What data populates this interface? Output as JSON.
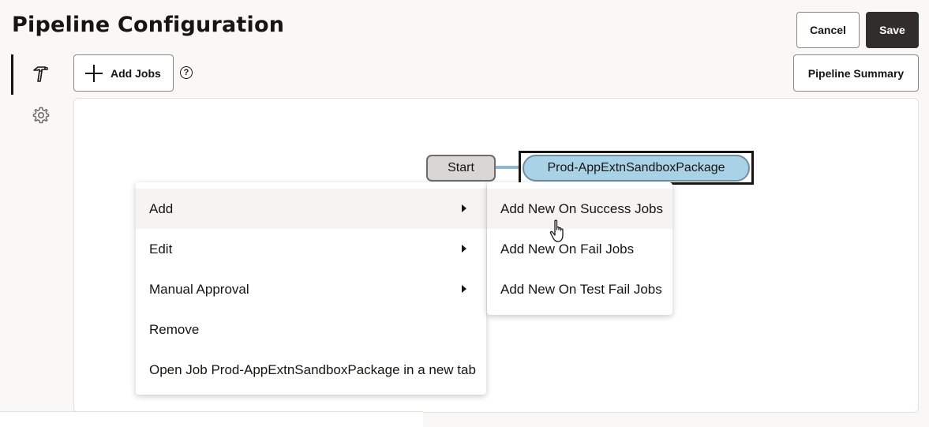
{
  "header": {
    "title": "Pipeline Configuration",
    "cancel_label": "Cancel",
    "save_label": "Save"
  },
  "toolbar": {
    "add_jobs_label": "Add Jobs",
    "help_glyph": "?",
    "pipeline_summary_label": "Pipeline Summary"
  },
  "sidebar": {
    "items": [
      {
        "icon": "hammer-icon",
        "active": true
      },
      {
        "icon": "gear-icon",
        "active": false
      }
    ]
  },
  "graph": {
    "nodes": [
      {
        "label": "Start",
        "type": "start"
      },
      {
        "label": "Prod-AppExtnSandboxPackage",
        "type": "job",
        "selected": true
      }
    ]
  },
  "context_menu": {
    "items": [
      {
        "label": "Add",
        "has_submenu": true,
        "highlighted": true
      },
      {
        "label": "Edit",
        "has_submenu": true
      },
      {
        "label": "Manual Approval",
        "has_submenu": true
      },
      {
        "label": "Remove",
        "has_submenu": false
      },
      {
        "label": "Open Job Prod-AppExtnSandboxPackage in a new tab",
        "has_submenu": false
      }
    ]
  },
  "submenu": {
    "items": [
      {
        "label": "Add New On Success Jobs",
        "highlighted": true
      },
      {
        "label": "Add New On Fail Jobs"
      },
      {
        "label": "Add New On Test Fail Jobs"
      }
    ]
  },
  "colors": {
    "background": "#f9f8f6",
    "primary_button": "#312d2a",
    "job_node_fill": "#a9d2e6",
    "start_node_fill": "#d9d7d6",
    "connector": "#8fb8cf"
  }
}
